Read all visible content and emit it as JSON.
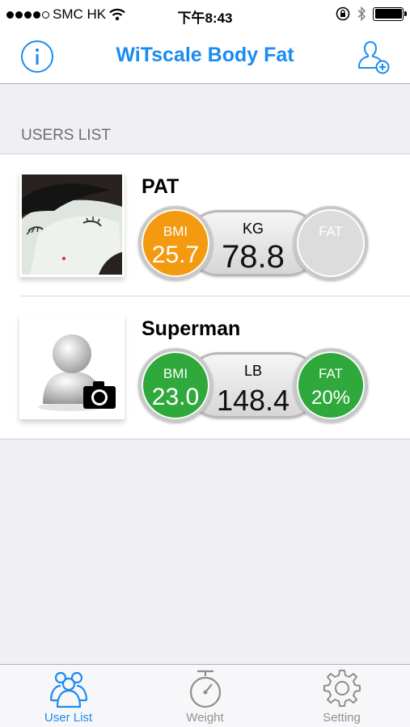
{
  "status_bar": {
    "carrier": "SMC HK",
    "time": "下午8:43"
  },
  "nav": {
    "title": "WiTscale Body Fat"
  },
  "section_header": "USERS LIST",
  "users": [
    {
      "name": "PAT",
      "avatar": "photo",
      "bmi": {
        "label": "BMI",
        "value": "25.7",
        "color": "#f39a10"
      },
      "weight": {
        "unit": "KG",
        "value": "78.8"
      },
      "fat": {
        "label": "FAT",
        "value": "",
        "color": "#dcdcdc"
      }
    },
    {
      "name": "Superman",
      "avatar": "default-user-camera",
      "bmi": {
        "label": "BMI",
        "value": "23.0",
        "color": "#2fa83c"
      },
      "weight": {
        "unit": "LB",
        "value": "148.4"
      },
      "fat": {
        "label": "FAT",
        "value": "20%",
        "color": "#2fa83c"
      }
    }
  ],
  "tabs": [
    {
      "label": "User List",
      "icon": "users-icon",
      "active": true
    },
    {
      "label": "Weight",
      "icon": "stopwatch-icon",
      "active": false
    },
    {
      "label": "Setting",
      "icon": "gear-icon",
      "active": false
    }
  ],
  "colors": {
    "accent": "#1a8cf0",
    "bmi_over": "#f39a10",
    "ok": "#2fa83c"
  }
}
